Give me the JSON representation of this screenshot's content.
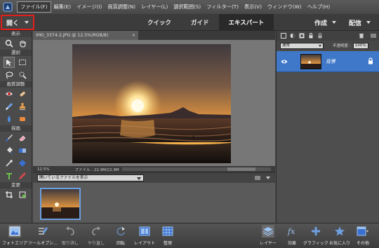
{
  "menubar": {
    "items": [
      "ファイル(F)",
      "編集(E)",
      "イメージ(I)",
      "画質調整(N)",
      "レイヤー(L)",
      "選択範囲(S)",
      "フィルター(T)",
      "表示(V)",
      "ウィンドウ(W)",
      "ヘルプ(H)"
    ],
    "active_item": "ファイル(F)"
  },
  "modebar": {
    "open_label": "開く",
    "tabs": [
      "クイック",
      "ガイド",
      "エキスパート"
    ],
    "selected_tab": "エキスパート",
    "create_label": "作成",
    "share_label": "配信"
  },
  "toolbox": {
    "sections": [
      "表示",
      "選択",
      "画質調整",
      "描画",
      "変更"
    ]
  },
  "document": {
    "tab_title": "IMG_3374-2.JPG @ 12.5%(RGB/8)",
    "zoom_status": "12.5%",
    "file_status": "ファイル : 22.9M/22.9M"
  },
  "photo_bin": {
    "show_select": "開いているファイルを表示"
  },
  "layers_panel": {
    "blend_mode": "通常",
    "opacity_label": "不透明度 :",
    "opacity_value": "100%",
    "layer_name": "背景"
  },
  "bottombar": {
    "left": [
      "フォトエリア",
      "ツールオプシ...",
      "取り消し",
      "やり直し",
      "回転",
      "レイアウト",
      "整理"
    ],
    "right": [
      "レイヤー",
      "効果",
      "グラフィック",
      "お気に入り",
      "その他"
    ]
  },
  "colors": {
    "accent_red": "#e0201c",
    "selection_blue": "#3f78c9",
    "thumb_border": "#6c9fdf"
  }
}
